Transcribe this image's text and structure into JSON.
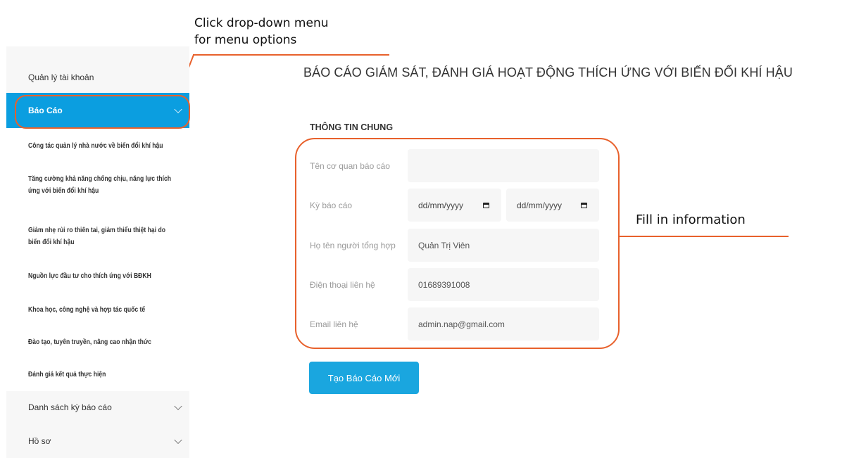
{
  "annotations": {
    "dropdown_line1": "Click drop-down menu",
    "dropdown_line2": "for menu options",
    "fill_in": "Fill in information"
  },
  "sidebar": {
    "account": "Quản lý tài khoản",
    "report": "Báo Cáo",
    "sub_items": [
      "Công tác quản lý nhà nước về biến đổi khí hậu",
      "Tăng cường khả năng chống chịu, năng lực thích",
      "ứng với biến đổi khí hậu",
      "Giảm nhẹ rủi ro thiên tai, giảm thiểu thiệt hại do",
      "biến đổi khí hậu",
      "Nguồn lực đầu tư cho thích ứng với BĐKH",
      "Khoa học, công nghệ và hợp tác quốc tế",
      "Đào tạo, tuyên truyền, nâng cao nhận thức",
      "Đánh giá kết quả thực hiện"
    ],
    "period_list": "Danh sách kỳ báo cáo",
    "profile": "Hồ sơ"
  },
  "main": {
    "title": "BÁO CÁO GIÁM SÁT, ĐÁNH GIÁ HOẠT ĐỘNG THÍCH ỨNG VỚI BIẾN ĐỔI KHÍ HẬU",
    "section_title": "THÔNG TIN CHUNG",
    "fields": {
      "agency_label": "Tên cơ quan báo cáo",
      "agency_value": "",
      "period_label": "Kỳ báo cáo",
      "period_from": "dd/mm/yyyy",
      "period_to": "dd/mm/yyyy",
      "compiler_label": "Họ tên người tổng hợp",
      "compiler_value": "Quản Trị Viên",
      "phone_label": "Điện thoại liên hệ",
      "phone_value": "01689391008",
      "email_label": "Email liên hệ",
      "email_value": "admin.nap@gmail.com"
    },
    "create_button": "Tạo Báo Cáo Mới"
  },
  "colors": {
    "accent": "#0b9ee0",
    "button": "#1aa6df",
    "annotation": "#e8612c"
  }
}
